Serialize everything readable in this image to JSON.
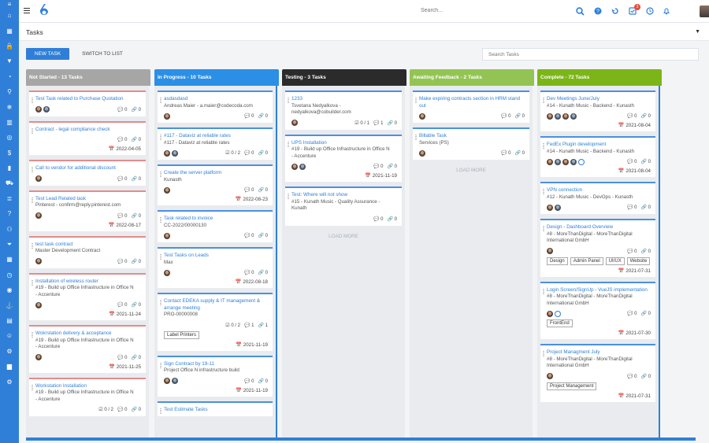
{
  "search_top": {
    "placeholder": "Search..."
  },
  "topbar": {
    "notification_count": "3"
  },
  "page": {
    "title": "Tasks",
    "new_task": "NEW TASK",
    "switch_to_list": "SWITCH TO LIST",
    "search_placeholder": "Search Tasks"
  },
  "colors": {
    "accent": "#2f7fd8",
    "not_started": "#a6a6a6",
    "in_progress": "#2b8fe6",
    "testing": "#2b2b2b",
    "awaiting": "#93c453",
    "complete": "#7cb518"
  },
  "columns": [
    {
      "title": "Not Started - 13 Tasks",
      "cards": [
        {
          "title": "Test Task related to Purchase Quotation",
          "sub": [],
          "avatars": 2,
          "comments": "0",
          "attachments": "0",
          "checks": "",
          "date": ""
        },
        {
          "title": "Contract - legal compliance check",
          "sub": [],
          "avatars": 0,
          "comments": "0",
          "attachments": "0",
          "checks": "",
          "date": "2022-04-05"
        },
        {
          "title": "Call to vendor for additional discount",
          "sub": [],
          "avatars": 1,
          "comments": "0",
          "attachments": "0",
          "checks": "",
          "date": ""
        },
        {
          "title": "Test Lead Related task",
          "sub": [
            "Pinterest - confirm@reply.pinterest.com"
          ],
          "avatars": 1,
          "comments": "0",
          "attachments": "0",
          "checks": "",
          "date": "2022-08-17"
        },
        {
          "title": "test task contract",
          "sub": [
            "Master Development Contract"
          ],
          "avatars": 1,
          "comments": "0",
          "attachments": "0",
          "checks": "",
          "date": ""
        },
        {
          "title": "Installation of wireless router",
          "sub": [
            "#19 - Build up Office Infrastructure in Office N",
            "- Accenture"
          ],
          "avatars": 1,
          "comments": "0",
          "attachments": "0",
          "checks": "",
          "date": "2021-11-24"
        },
        {
          "title": "Wokrstation delivery & acceptance",
          "sub": [
            "#19 - Build up Office Infrastructure in Office N",
            "- Accenture"
          ],
          "avatars": 1,
          "comments": "0",
          "attachments": "0",
          "checks": "",
          "date": "2021-11-25"
        },
        {
          "title": "Workstation Installation",
          "sub": [
            "#19 - Build up Office Infrastructure in Office N",
            "- Accenture"
          ],
          "avatars": 0,
          "comments": "0",
          "attachments": "0",
          "checks": "0 / 2",
          "date": ""
        }
      ]
    },
    {
      "title": "In Progress - 10 Tasks",
      "cards": [
        {
          "title": "asdasdasd",
          "sub": [
            "Andreas Maier - a.maier@codecoda.com"
          ],
          "avatars": 1,
          "comments": "0",
          "attachments": "0",
          "checks": "",
          "date": ""
        },
        {
          "title": "#117 - Dataviz at reliable rates",
          "sub": [
            "#117 - Dataviz at reliable rates"
          ],
          "avatars": 2,
          "comments": "0",
          "attachments": "0",
          "checks": "0 / 2",
          "date": ""
        },
        {
          "title": "Create the server platform",
          "sub": [
            "Kunasth"
          ],
          "avatars": 1,
          "comments": "0",
          "attachments": "0",
          "checks": "",
          "date": "2022-08-23"
        },
        {
          "title": "Task related to invoice",
          "sub": [
            "CC-2022/00000130"
          ],
          "avatars": 1,
          "comments": "0",
          "attachments": "0",
          "checks": "",
          "date": ""
        },
        {
          "title": "Test Tasks on Leads",
          "sub": [
            "Max"
          ],
          "avatars": 1,
          "comments": "0",
          "attachments": "0",
          "checks": "",
          "date": "2022-08-18"
        },
        {
          "title": "Contact EDEKA supply & IT management & arrange meeting",
          "sub": [
            "PRO-00000008"
          ],
          "avatars": 0,
          "comments": "1",
          "attachments": "1",
          "checks": "0 / 2",
          "date": "2021-11-19",
          "tags": [
            "Label Printers"
          ]
        },
        {
          "title": "Sign Contract by 19-11",
          "sub": [
            "Project Office N infrastructure build"
          ],
          "avatars": 2,
          "comments": "0",
          "attachments": "0",
          "checks": "",
          "date": "2021-11-19"
        },
        {
          "title": "Test Estimate Tasks",
          "sub": [],
          "avatars": 0,
          "comments": "",
          "attachments": "",
          "checks": "",
          "date": ""
        }
      ]
    },
    {
      "title": "Testing - 3 Tasks",
      "cards": [
        {
          "title": "1233",
          "sub": [
            "Tsvetana Nedyalkova -",
            "nedyalkova@cobuilder.com"
          ],
          "avatars": 1,
          "comments": "1",
          "attachments": "0",
          "checks": "0 / 1",
          "date": ""
        },
        {
          "title": "UPS Installation",
          "sub": [
            "#19 - Build up Office Infrastructure in Office N",
            "- Accenture"
          ],
          "avatars": 2,
          "comments": "0",
          "attachments": "0",
          "checks": "",
          "date": "2021-11-19"
        },
        {
          "title": "Test: Where will not show",
          "sub": [
            "#15 - Kunath Music - Quality Assurance -",
            "Kunath"
          ],
          "avatars": 0,
          "comments": "0",
          "attachments": "0",
          "checks": "",
          "date": ""
        }
      ],
      "load_more": "LOAD MORE"
    },
    {
      "title": "Awaiting Feedback - 2 Tasks",
      "cards": [
        {
          "title": "Make expiring contracts section in HRM stand out",
          "sub": [],
          "avatars": 1,
          "comments": "0",
          "attachments": "0",
          "checks": "",
          "date": ""
        },
        {
          "title": "Billable Task",
          "sub": [
            "Services (PS)"
          ],
          "avatars": 1,
          "comments": "0",
          "attachments": "0",
          "checks": "",
          "date": ""
        }
      ],
      "load_more": "LOAD MORE"
    },
    {
      "title": "Complete - 72 Tasks",
      "cards": [
        {
          "title": "Dev Meetings June/July",
          "sub": [
            "#14 - Kunath Music - Backend - Kunasth"
          ],
          "avatars": 4,
          "comments": "0",
          "attachments": "0",
          "checks": "",
          "date": "2021-08-04"
        },
        {
          "title": "FedEx Plugin development",
          "sub": [
            "#14 - Kunath Music - Backend - Kunasth"
          ],
          "avatars": 4,
          "comments": "0",
          "attachments": "0",
          "checks": "",
          "date": "2021-08-04"
        },
        {
          "title": "VPN connection",
          "sub": [
            "#12 - Kunath Music - DevOps - Kunasth"
          ],
          "avatars": 2,
          "comments": "0",
          "attachments": "0",
          "checks": "",
          "date": ""
        },
        {
          "title": "Design - Dashboard Overview",
          "sub": [
            "#8 - MoreThanDigital - MoreThanDigital",
            "International GmbH"
          ],
          "avatars": 1,
          "comments": "0",
          "attachments": "0",
          "checks": "",
          "date": "2021-07-31",
          "tags": [
            "Design",
            "Admin Panel",
            "UI/UX",
            "Website"
          ]
        },
        {
          "title": "Login Screen/SignUp - VueJS implementation",
          "sub": [
            "#8 - MoreThanDigital - MoreThanDigital",
            "International GmbH"
          ],
          "avatars": 1,
          "comments": "0",
          "attachments": "0",
          "checks": "",
          "date": "2021-07-30",
          "tags": [
            "FrontEnd"
          ]
        },
        {
          "title": "Project Managment July",
          "sub": [
            "#8 - MoreThanDigital - MoreThanDigital",
            "International GmbH"
          ],
          "avatars": 1,
          "comments": "0",
          "attachments": "0",
          "checks": "",
          "date": "2021-07-31",
          "tags": [
            "Project Management"
          ]
        }
      ]
    }
  ],
  "leftbar_icons": [
    "menu-icon",
    "dashboard-icon",
    "calendar-icon",
    "lock-icon",
    "filter-icon",
    "chart-icon",
    "location-icon",
    "snowflake-icon",
    "factory-icon",
    "globe-icon",
    "dollar-icon",
    "bar-chart-icon",
    "car-icon",
    "list-icon",
    "help-icon",
    "people-icon",
    "funnel-icon",
    "calendar2-icon",
    "clock-icon",
    "user-icon",
    "anchor-icon",
    "book-icon",
    "person-icon",
    "cogs-icon",
    "chart2-icon",
    "gear-icon"
  ],
  "leftbar_glyphs": [
    "≡",
    "⌂",
    "▦",
    "🔒",
    "▼",
    "◔",
    "⚲",
    "❄",
    "▥",
    "◎",
    "$",
    "▮",
    "⛟",
    "≣",
    "?",
    "⚇",
    "⏷",
    "▦",
    "◷",
    "◉",
    "⚓",
    "▤",
    "☺",
    "⚙",
    "▆",
    "⚙"
  ]
}
